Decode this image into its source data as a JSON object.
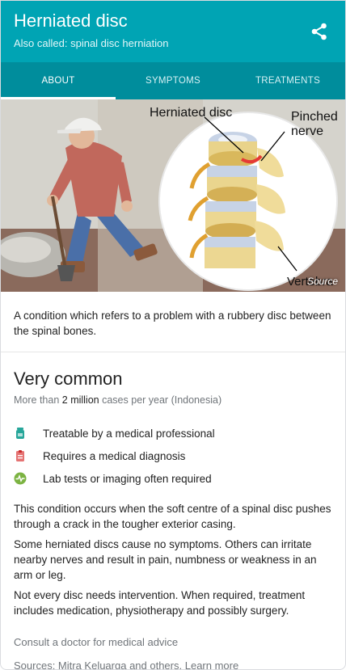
{
  "header": {
    "title": "Herniated disc",
    "subtitle": "Also called: spinal disc herniation",
    "share_icon": "share-icon",
    "color": "#00a4b4"
  },
  "tabs": [
    {
      "label": "ABOUT",
      "active": true
    },
    {
      "label": "SYMPTOMS",
      "active": false
    },
    {
      "label": "TREATMENTS",
      "active": false
    }
  ],
  "hero": {
    "labels": {
      "herniated_disc": "Herniated disc",
      "pinched_line1": "Pinched",
      "pinched_line2": "nerve",
      "vertebra": "Vertebra"
    },
    "source": "Source"
  },
  "description": "A condition which refers to a problem with a rubbery disc between the spinal bones.",
  "frequency": {
    "title": "Very common",
    "prefix": "More than",
    "count": "2 million",
    "suffix": "cases per year (Indonesia)"
  },
  "facts": [
    {
      "icon": "medicine-bottle-icon",
      "color": "#26a69a",
      "text": "Treatable by a medical professional"
    },
    {
      "icon": "clipboard-icon",
      "color": "#e57373",
      "text": "Requires a medical diagnosis"
    },
    {
      "icon": "pulse-icon",
      "color": "#7cb342",
      "text": "Lab tests or imaging often required"
    }
  ],
  "paragraphs": [
    "This condition occurs when the soft centre of a spinal disc pushes through a crack in the tougher exterior casing.",
    "Some herniated discs cause no symptoms. Others can irritate nearby nerves and result in pain, numbness or weakness in an arm or leg.",
    "Not every disc needs intervention. When required, treatment includes medication, physiotherapy and possibly surgery."
  ],
  "footer": {
    "consult": "Consult a doctor for medical advice",
    "sources": "Sources: Mitra Keluarga and others.",
    "learn_more": "Learn more"
  }
}
